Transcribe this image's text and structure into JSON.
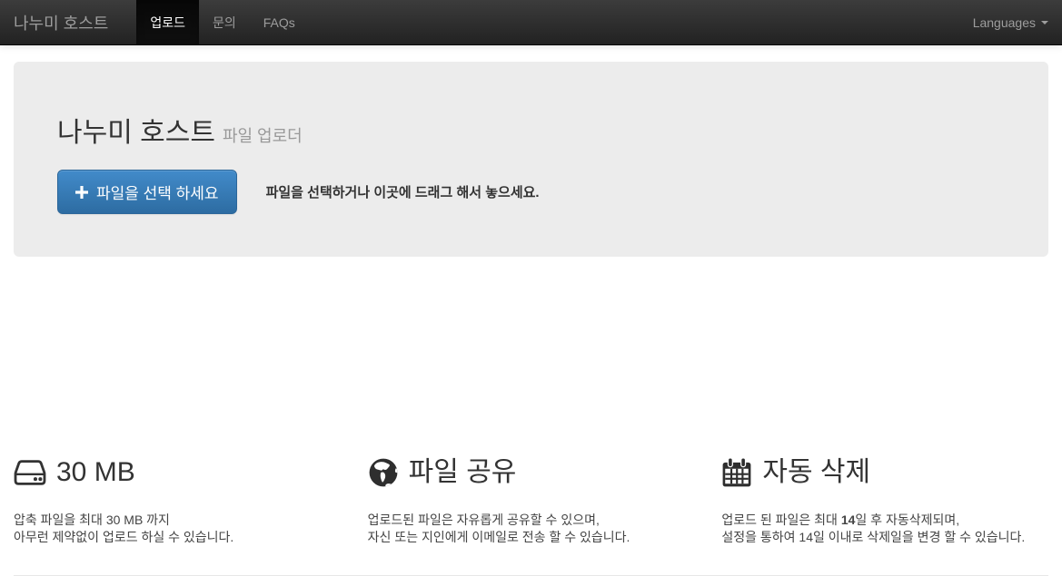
{
  "navbar": {
    "brand": "나누미 호스트",
    "items": [
      {
        "label": "업로드",
        "active": true
      },
      {
        "label": "문의",
        "active": false
      },
      {
        "label": "FAQs",
        "active": false
      }
    ],
    "languages_label": "Languages"
  },
  "jumbotron": {
    "title": "나누미 호스트",
    "subtitle": "파일 업로더",
    "button_label": "파일을 선택 하세요",
    "drag_hint": "파일을 선택하거나 이곳에 드래그 해서 놓으세요."
  },
  "features": [
    {
      "icon": "hdd-icon",
      "title": "30 MB",
      "line1": "압축 파일을 최대 30 MB 까지",
      "line2": "아무런 제약없이 업로드 하실 수 있습니다."
    },
    {
      "icon": "globe-icon",
      "title": "파일 공유",
      "line1": "업로드된 파일은 자유롭게 공유할 수 있으며,",
      "line2": "자신 또는 지인에게 이메일로 전송 할 수 있습니다."
    },
    {
      "icon": "calendar-icon",
      "title": "자동 삭제",
      "line1_prefix": "업로드 된 파일은 최대 ",
      "line1_bold": "14",
      "line1_suffix": "일 후 자동삭제되며,",
      "line2": "설정을 통하여 14일 이내로 삭제일을 변경 할 수 있습니다."
    }
  ],
  "colors": {
    "navbar_top": "#3c3c3c",
    "navbar_bottom": "#222222",
    "navbar_active_bg": "#080808",
    "navbar_link": "#9d9d9d",
    "button_top": "#428bca",
    "button_bottom": "#2d6ca2",
    "button_border": "#2b669a",
    "jumbotron_bg": "#ececec",
    "heading_text": "#333333",
    "muted_text": "#999999"
  }
}
